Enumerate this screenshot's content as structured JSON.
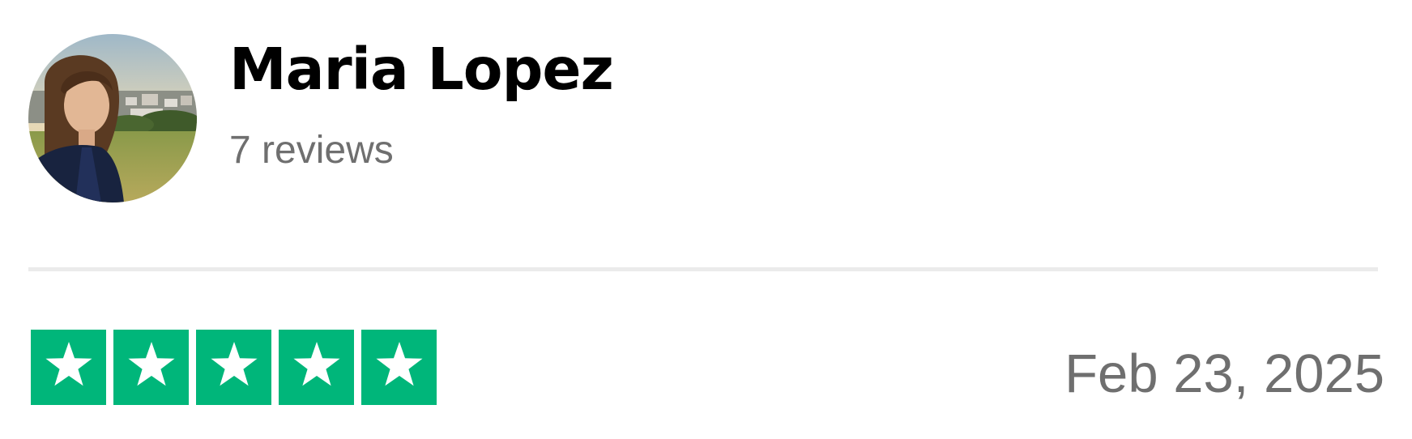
{
  "reviewer": {
    "name": "Maria Lopez",
    "review_count_text": "7 reviews",
    "avatar": "avatar-photo"
  },
  "review": {
    "rating": 5,
    "rating_max": 5,
    "star_icon": "star-icon",
    "date": "Feb 23, 2025"
  },
  "colors": {
    "star_fill": "#00b67a",
    "star_glyph": "#ffffff",
    "name_text": "#000000",
    "muted_text": "#6f6f6f",
    "divider": "#ebebeb"
  }
}
